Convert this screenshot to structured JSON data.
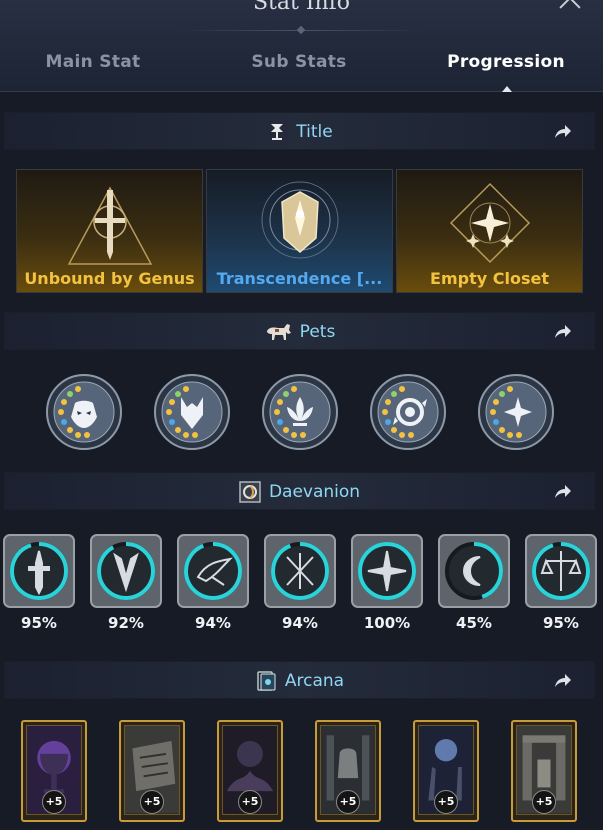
{
  "window": {
    "title": "Stat Info"
  },
  "tabs": [
    {
      "label": "Main Stat",
      "active": false
    },
    {
      "label": "Sub Stats",
      "active": false
    },
    {
      "label": "Progression",
      "active": true
    }
  ],
  "sections": {
    "title": {
      "label": "Title",
      "icon": "title-icon"
    },
    "pets": {
      "label": "Pets",
      "icon": "horse-icon"
    },
    "daevanion": {
      "label": "Daevanion",
      "icon": "daevanion-icon"
    },
    "arcana": {
      "label": "Arcana",
      "icon": "arcana-card-icon"
    }
  },
  "titles": [
    {
      "name": "Unbound by Genus",
      "tier": "gold",
      "icon": "sword-triangle-emblem"
    },
    {
      "name": "Transcendence [...",
      "tier": "blue",
      "icon": "shield-emblem"
    },
    {
      "name": "Empty Closet",
      "tier": "gold",
      "icon": "star-diamond-emblem"
    }
  ],
  "pets": [
    {
      "icon": "mask-pet-icon"
    },
    {
      "icon": "wolf-pet-icon"
    },
    {
      "icon": "lotus-pet-icon"
    },
    {
      "icon": "vortex-pet-icon"
    },
    {
      "icon": "star-pet-icon"
    }
  ],
  "daevanion": [
    {
      "percent": "95%",
      "progress": 0.95,
      "icon": "sword-emblem-icon"
    },
    {
      "percent": "92%",
      "progress": 0.92,
      "icon": "claw-emblem-icon"
    },
    {
      "percent": "94%",
      "progress": 0.94,
      "icon": "bird-emblem-icon"
    },
    {
      "percent": "94%",
      "progress": 0.94,
      "icon": "cross-blades-emblem-icon"
    },
    {
      "percent": "100%",
      "progress": 1.0,
      "icon": "compass-emblem-icon"
    },
    {
      "percent": "45%",
      "progress": 0.45,
      "icon": "moon-emblem-icon"
    },
    {
      "percent": "95%",
      "progress": 0.95,
      "icon": "balance-emblem-icon"
    }
  ],
  "arcana": [
    {
      "badge": "+5",
      "art": "chalice-card"
    },
    {
      "badge": "+5",
      "art": "scroll-card"
    },
    {
      "badge": "+5",
      "art": "ruins-card"
    },
    {
      "badge": "+5",
      "art": "bell-card"
    },
    {
      "badge": "+5",
      "art": "hands-card"
    },
    {
      "badge": "+5",
      "art": "gate-card"
    }
  ],
  "colors": {
    "accent_cyan": "#8fd7f2",
    "title_gold": "#f3c33f",
    "title_blue": "#54a9f0",
    "progress_ring": "#29d3d9"
  }
}
